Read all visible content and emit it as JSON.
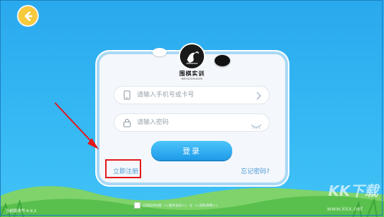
{
  "header": {
    "back_icon": "back-arrow-icon"
  },
  "brand": {
    "name": "围棋实训",
    "subtitle": "WEIQISHIXUN"
  },
  "form": {
    "phone_placeholder": "请输入手机号或卡号",
    "password_placeholder": "请输入密码",
    "phone_icon": "phone-icon",
    "lock_icon": "lock-icon",
    "eye_icon": "eye-closed-icon",
    "chevron_icon": "chevron-right-icon",
    "login_label": "登录",
    "register_label": "立即注册",
    "forgot_label": "忘记密码?"
  },
  "footer": {
    "version": "当前版本号:4.9.2",
    "agreement_prefix": "已阅读并同意",
    "service_link": "<<服务协议>>",
    "connector": "与",
    "privacy_link": "<<隐私策略>>"
  },
  "watermark": {
    "main": "KK下载",
    "sub": "www.kkx.net"
  },
  "colors": {
    "background": "#35b8f3",
    "accent": "#1f9ce9",
    "link": "#4b9ad6",
    "highlight": "#e3161b",
    "back_button": "#f7c93c"
  }
}
